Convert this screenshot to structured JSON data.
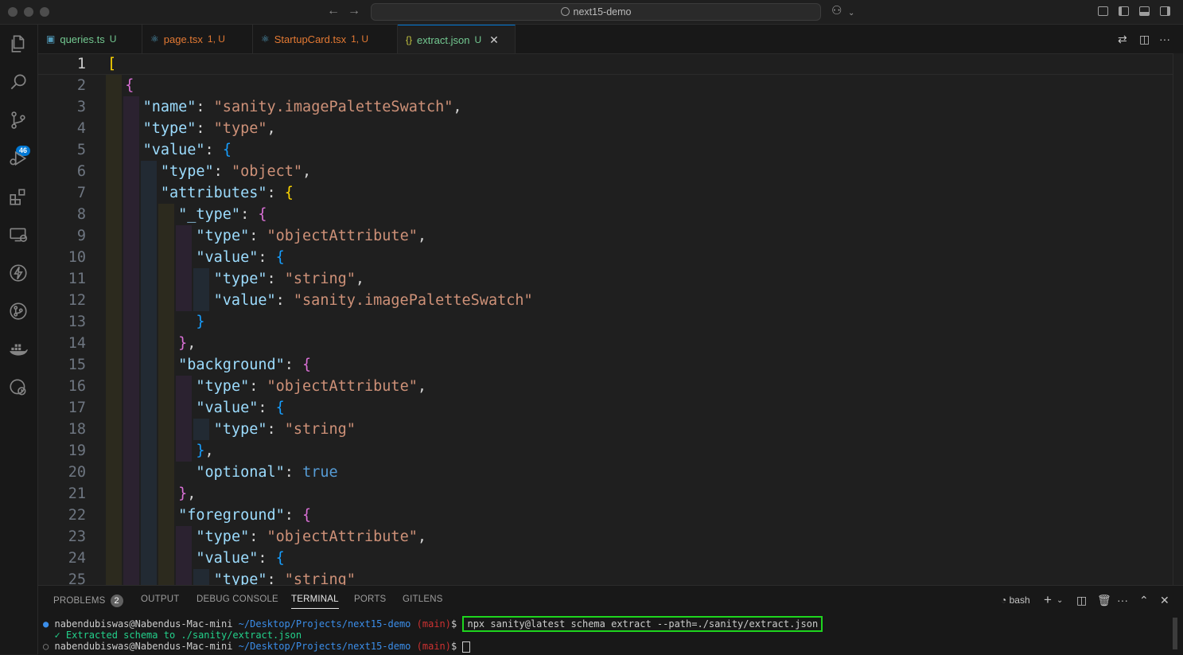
{
  "window": {
    "search_title": "next15-demo"
  },
  "activity": {
    "scm_badge": "46"
  },
  "tabs": [
    {
      "name": "queries.ts",
      "status": "U",
      "icon": "ts-icon",
      "color": "#519aba"
    },
    {
      "name": "page.tsx",
      "status": "1, U",
      "icon": "react-icon",
      "color": "#e37933"
    },
    {
      "name": "StartupCard.tsx",
      "status": "1, U",
      "icon": "react-icon",
      "color": "#e37933"
    },
    {
      "name": "extract.json",
      "status": "U",
      "icon": "json-icon",
      "color": "#cccccc"
    }
  ],
  "editor": {
    "line_numbers": [
      "1",
      "2",
      "3",
      "4",
      "5",
      "6",
      "7",
      "8",
      "9",
      "10",
      "11",
      "12",
      "13",
      "14",
      "15",
      "16",
      "17",
      "18",
      "19",
      "20",
      "21",
      "22",
      "23",
      "24",
      "25"
    ],
    "tokens": {
      "t1": "[",
      "t2": "{",
      "k_name": "\"name\"",
      "s_name": "\"sanity.imagePaletteSwatch\"",
      "k_type": "\"type\"",
      "s_type": "\"type\"",
      "k_value": "\"value\"",
      "s_object": "\"object\"",
      "k_attributes": "\"attributes\"",
      "k__type": "\"_type\"",
      "s_objectAttribute": "\"objectAttribute\"",
      "s_string": "\"string\"",
      "s_sanity": "\"sanity.imagePaletteSwatch\"",
      "k_background": "\"background\"",
      "k_optional": "\"optional\"",
      "v_true": "true",
      "k_foreground": "\"foreground\""
    }
  },
  "panel": {
    "tabs": [
      "PROBLEMS",
      "OUTPUT",
      "DEBUG CONSOLE",
      "TERMINAL",
      "PORTS",
      "GITLENS"
    ],
    "problems_count": "2",
    "shell": "bash"
  },
  "terminal": {
    "user": "nabendubiswas@Nabendus-Mac-mini",
    "dir": "~/Desktop/Projects/next15-demo",
    "branch": "(main)",
    "prompt": "$",
    "command": "npx sanity@latest schema extract --path=./sanity/extract.json",
    "output": "✓ Extracted schema to ./sanity/extract.json"
  }
}
